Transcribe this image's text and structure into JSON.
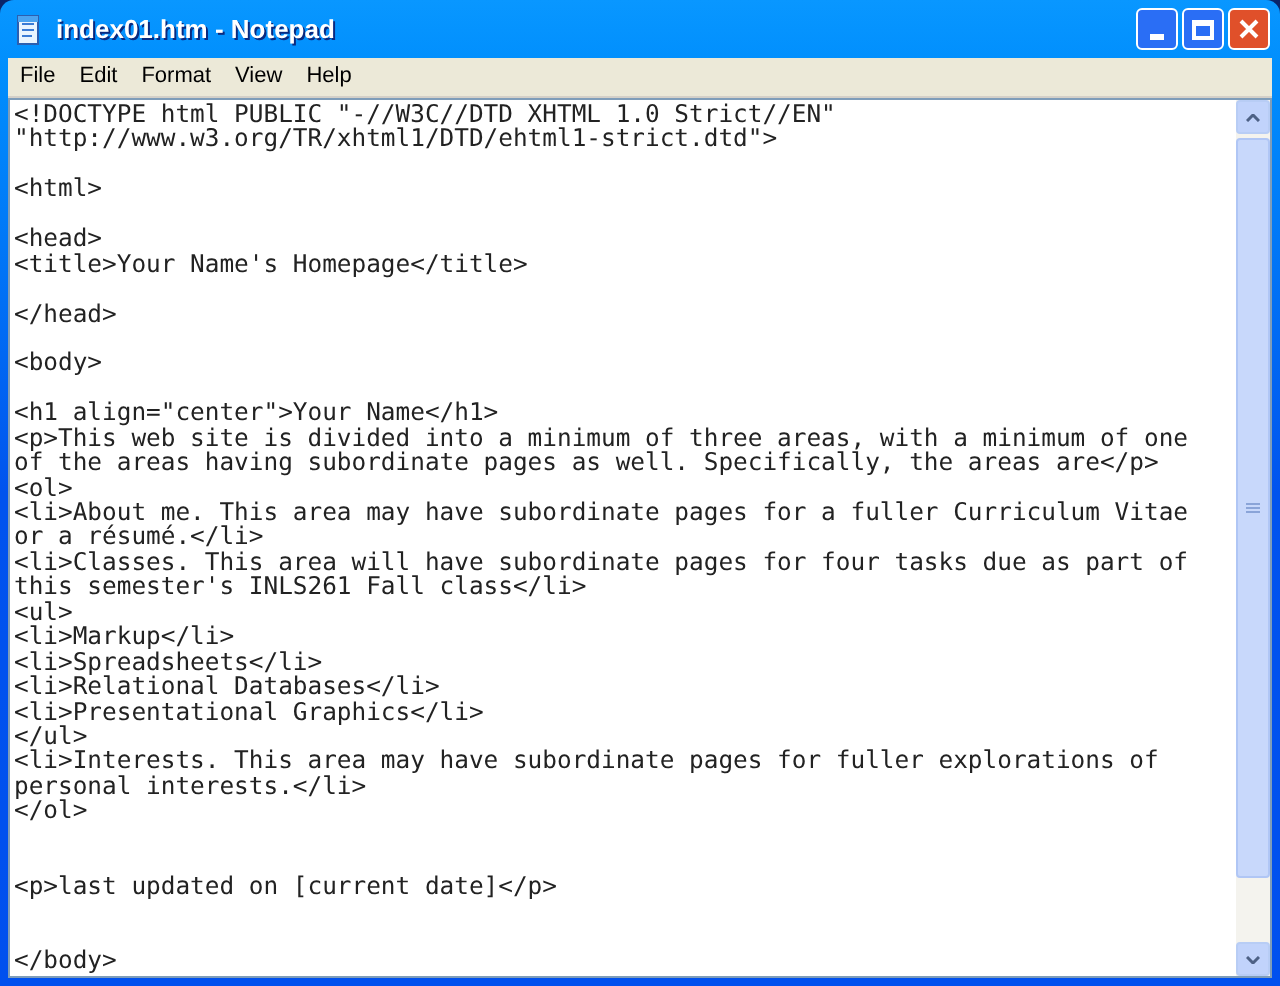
{
  "window": {
    "title": "index01.htm - Notepad"
  },
  "menu": [
    {
      "label": "File"
    },
    {
      "label": "Edit"
    },
    {
      "label": "Format"
    },
    {
      "label": "View"
    },
    {
      "label": "Help"
    }
  ],
  "lines": [
    {
      "kind": "code",
      "text": "<!DOCTYPE html PUBLIC \"-//W3C//DTD XHTML 1.0 Strict//EN\""
    },
    {
      "kind": "code",
      "text": "\"http://www.w3.org/TR/xhtml1/DTD/ehtml1-strict.dtd\">"
    },
    {
      "kind": "blank"
    },
    {
      "kind": "code",
      "text": "<html>"
    },
    {
      "kind": "blank"
    },
    {
      "kind": "code",
      "text": "<head>"
    },
    {
      "kind": "code",
      "text": "<title>Your Name's Homepage</title>"
    },
    {
      "kind": "blank"
    },
    {
      "kind": "code",
      "text": "</head>"
    },
    {
      "kind": "blank"
    },
    {
      "kind": "code",
      "text": "<body>"
    },
    {
      "kind": "blank"
    },
    {
      "kind": "code",
      "text": "<h1 align=\"center\">Your Name</h1>"
    },
    {
      "kind": "code",
      "text": "<p>This web site is divided into a minimum of three areas, with a minimum of one"
    },
    {
      "kind": "code",
      "text": "of the areas having subordinate pages as well. Specifically, the areas are</p>"
    },
    {
      "kind": "code",
      "text": "<ol>"
    },
    {
      "kind": "code",
      "text": "<li>About me. This area may have subordinate pages for a fuller Curriculum Vitae"
    },
    {
      "kind": "code",
      "text": "or a résumé.</li>"
    },
    {
      "kind": "code",
      "text": "<li>Classes. This area will have subordinate pages for four tasks due as part of"
    },
    {
      "kind": "code",
      "text": "this semester's INLS261 Fall class</li>"
    },
    {
      "kind": "code",
      "text": "<ul>"
    },
    {
      "kind": "code",
      "text": "<li>Markup</li>"
    },
    {
      "kind": "code",
      "text": "<li>Spreadsheets</li>"
    },
    {
      "kind": "code",
      "text": "<li>Relational Databases</li>"
    },
    {
      "kind": "code",
      "text": "<li>Presentational Graphics</li>"
    },
    {
      "kind": "code",
      "text": "</ul>"
    },
    {
      "kind": "code",
      "text": "<li>Interests. This area may have subordinate pages for fuller explorations of"
    },
    {
      "kind": "code",
      "text": "personal interests.</li>"
    },
    {
      "kind": "code",
      "text": "</ol>"
    },
    {
      "kind": "blank"
    },
    {
      "kind": "blank"
    },
    {
      "kind": "code",
      "text": "<p>last updated on [current date]</p>"
    },
    {
      "kind": "blank"
    },
    {
      "kind": "blank"
    },
    {
      "kind": "code",
      "text": "</body>"
    }
  ]
}
